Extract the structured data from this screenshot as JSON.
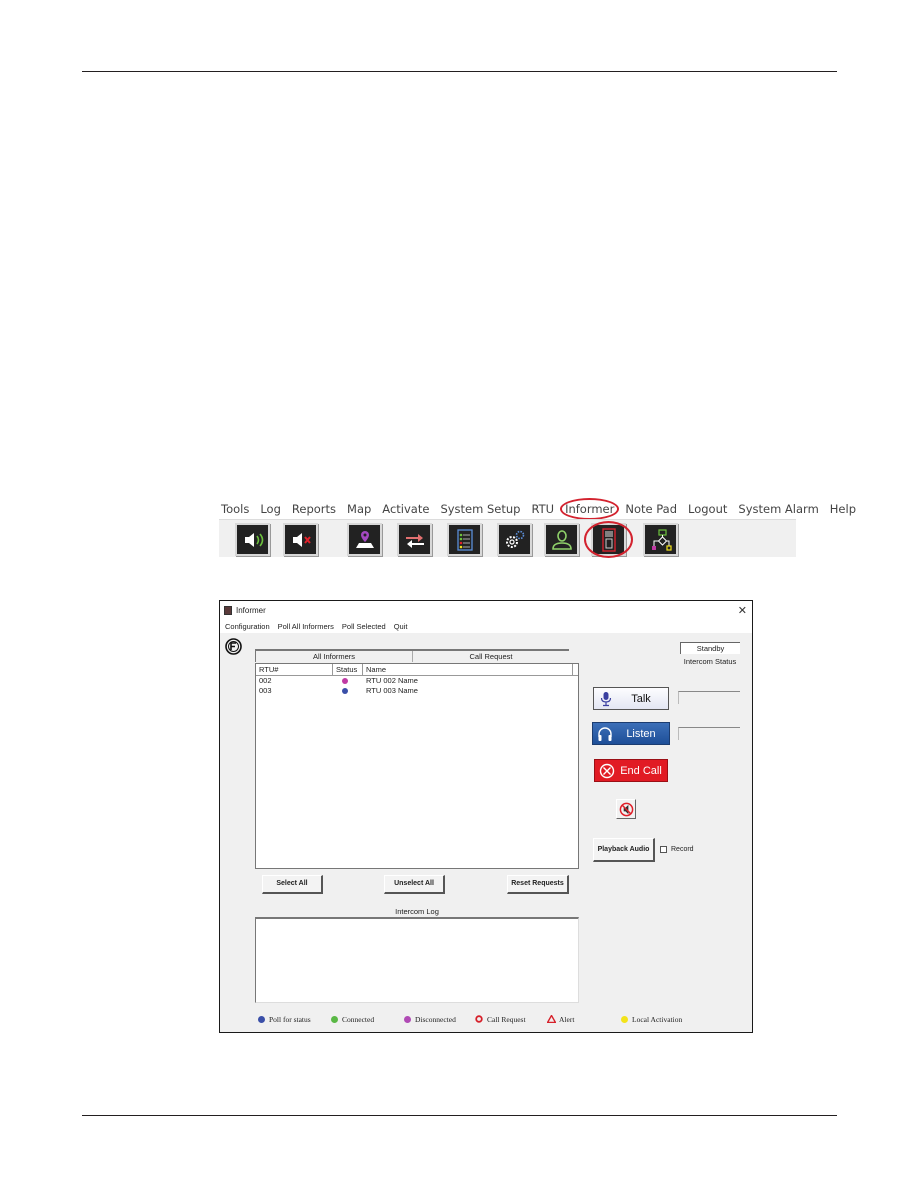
{
  "app_menu": {
    "items": [
      "Tools",
      "Log",
      "Reports",
      "Map",
      "Activate",
      "System Setup",
      "RTU",
      "Informer",
      "Note Pad",
      "Logout",
      "System Alarm",
      "Help"
    ],
    "highlighted": "Informer"
  },
  "toolbar": {
    "buttons": [
      {
        "icon": "speaker-on-icon"
      },
      {
        "icon": "speaker-mute-icon"
      },
      {
        "icon": "map-pin-icon"
      },
      {
        "icon": "transfer-arrows-icon"
      },
      {
        "icon": "checklist-icon"
      },
      {
        "icon": "gears-icon"
      },
      {
        "icon": "user-icon"
      },
      {
        "icon": "informer-device-icon",
        "highlighted": true
      },
      {
        "icon": "flowchart-icon"
      }
    ]
  },
  "window": {
    "title": "Informer",
    "close_label": "✕",
    "menu": [
      "Configuration",
      "Poll All Informers",
      "Poll Selected",
      "Quit"
    ],
    "grid": {
      "group_headers": [
        "All Informers",
        "Call Request"
      ],
      "columns": [
        "RTU#",
        "Status",
        "Name"
      ],
      "rows": [
        {
          "rtu": "002",
          "status_color": "#c03aa4",
          "name": "RTU 002 Name"
        },
        {
          "rtu": "003",
          "status_color": "#3a4fa8",
          "name": "RTU 003 Name"
        }
      ]
    },
    "buttons": {
      "select_all": "Select All",
      "unselect_all": "Unselect All",
      "reset_requests": "Reset Requests",
      "talk": "Talk",
      "listen": "Listen",
      "end_call": "End Call",
      "playback_audio": "Playback Audio"
    },
    "record_label": "Record",
    "record_checked": false,
    "intercom_status_value": "Standby",
    "intercom_status_label": "Intercom Status",
    "intercom_log_label": "Intercom Log",
    "legend": [
      {
        "label": "Poll for status",
        "color": "#3a4fa8",
        "shape": "dot"
      },
      {
        "label": "Connected",
        "color": "#5ab845",
        "shape": "dot"
      },
      {
        "label": "Disconnected",
        "color": "#b04ab5",
        "shape": "dot"
      },
      {
        "label": "Call Request",
        "color": "#d6202a",
        "shape": "ring"
      },
      {
        "label": "Alert",
        "color": "#d6202a",
        "shape": "triangle"
      },
      {
        "label": "Local Activation",
        "color": "#f3e31b",
        "shape": "dot"
      }
    ]
  }
}
